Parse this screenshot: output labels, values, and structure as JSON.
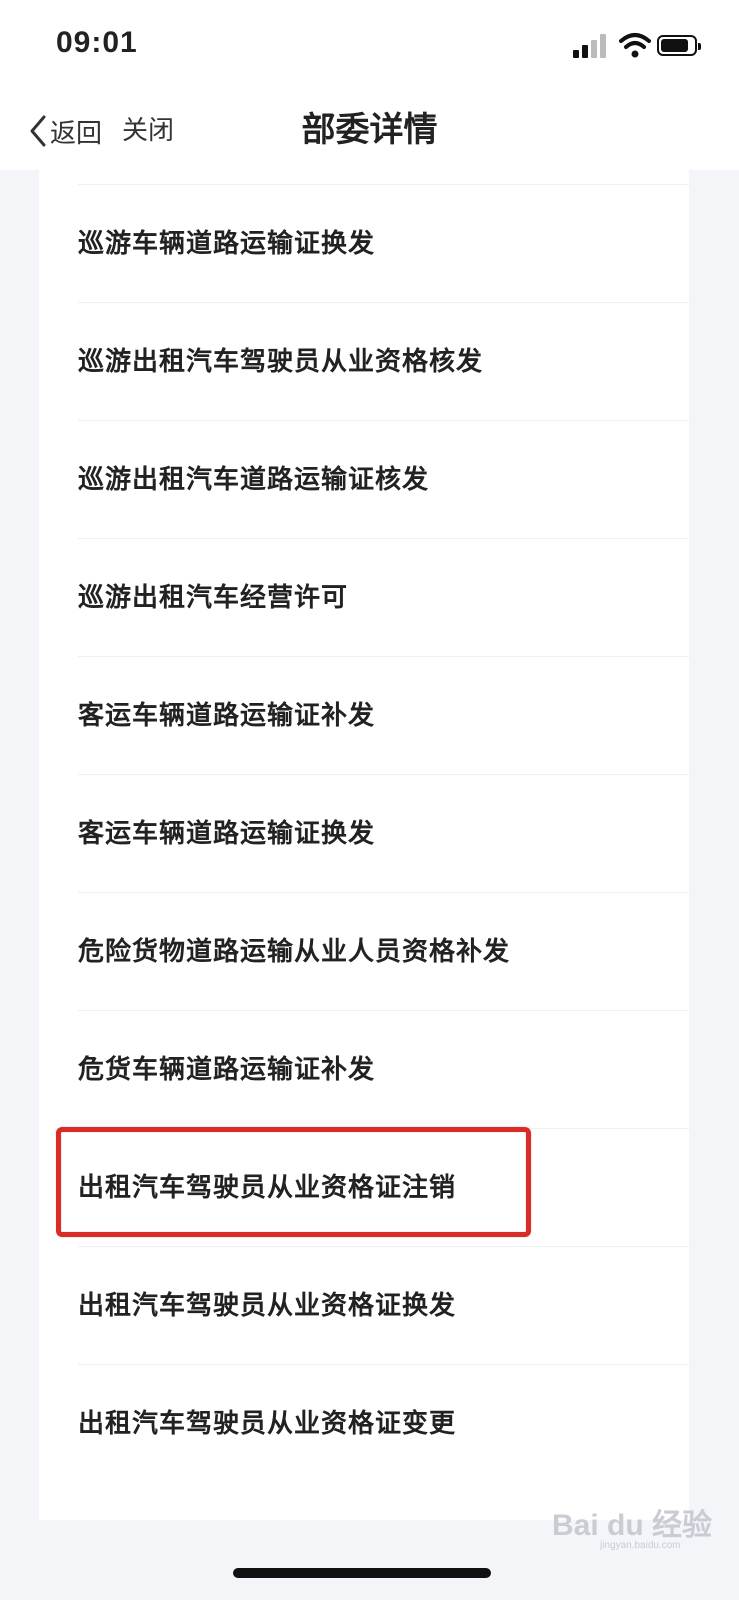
{
  "status": {
    "time": "09:01"
  },
  "nav": {
    "back_label": "返回",
    "close_label": "关闭",
    "title": "部委详情"
  },
  "items": [
    {
      "label": "巡游车辆道路运输证换发"
    },
    {
      "label": "巡游出租汽车驾驶员从业资格核发"
    },
    {
      "label": "巡游出租汽车道路运输证核发"
    },
    {
      "label": "巡游出租汽车经营许可"
    },
    {
      "label": "客运车辆道路运输证补发"
    },
    {
      "label": "客运车辆道路运输证换发"
    },
    {
      "label": "危险货物道路运输从业人员资格补发"
    },
    {
      "label": "危货车辆道路运输证补发"
    },
    {
      "label": "出租汽车驾驶员从业资格证注销",
      "highlighted": true
    },
    {
      "label": "出租汽车驾驶员从业资格证换发"
    },
    {
      "label": "出租汽车驾驶员从业资格证变更"
    }
  ],
  "watermark": {
    "brand": "Bai du 经验",
    "url": "jingyan.baidu.com"
  },
  "colors": {
    "highlight": "#e8261f",
    "background": "#f3f5f9"
  }
}
